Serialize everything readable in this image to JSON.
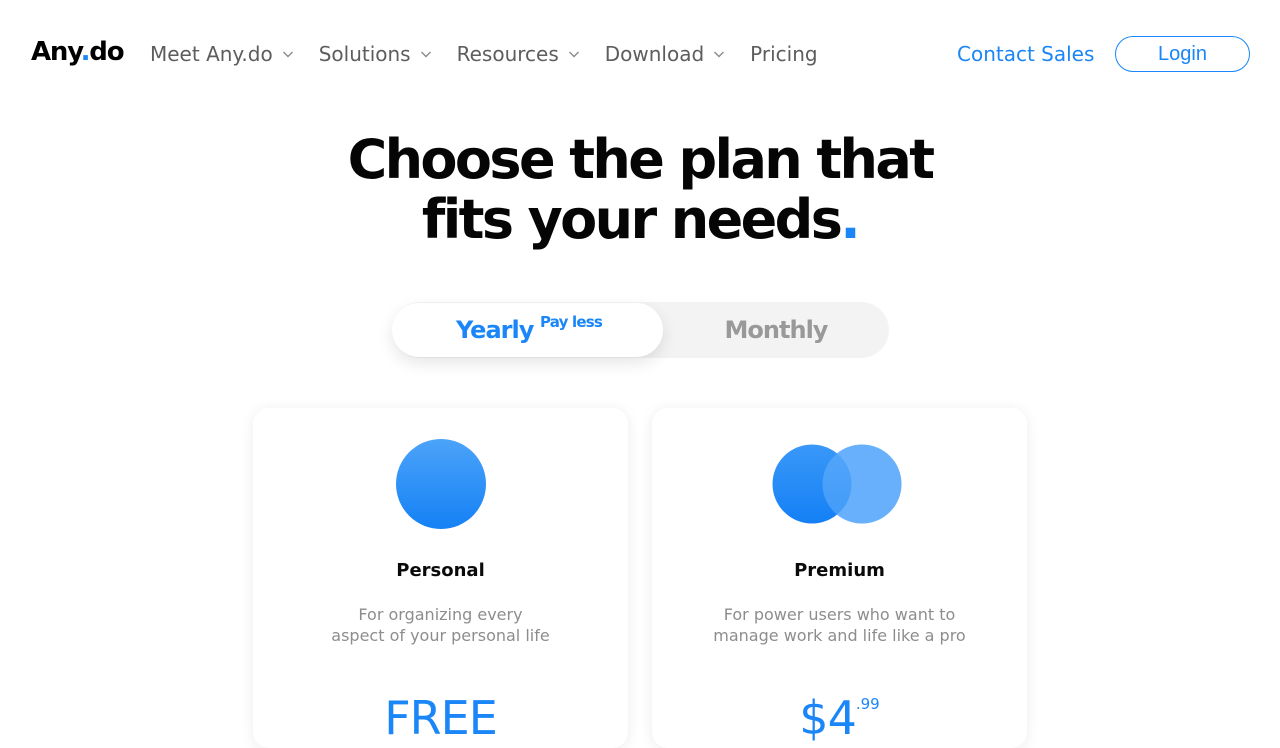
{
  "nav": {
    "logo_text": "Any",
    "logo_dot": ".",
    "logo_suffix": "do",
    "items": [
      {
        "label": "Meet Any.do",
        "has_dropdown": true
      },
      {
        "label": "Solutions",
        "has_dropdown": true
      },
      {
        "label": "Resources",
        "has_dropdown": true
      },
      {
        "label": "Download",
        "has_dropdown": true
      },
      {
        "label": "Pricing",
        "has_dropdown": false
      }
    ],
    "contact_sales": "Contact Sales",
    "login": "Login"
  },
  "hero": {
    "line1": "Choose the plan that",
    "line2": "fits your needs",
    "dot": "."
  },
  "billing_toggle": {
    "yearly_label": "Yearly",
    "yearly_badge": "Pay less",
    "monthly_label": "Monthly",
    "selected": "Yearly"
  },
  "plans": [
    {
      "name": "Personal",
      "description_line1": "For organizing every",
      "description_line2": "aspect of your personal life",
      "price": "FREE",
      "price_cents": ""
    },
    {
      "name": "Premium",
      "description_line1": "For power users who want to",
      "description_line2": "manage work and life like a pro",
      "price": "$4",
      "price_cents": ".99"
    }
  ],
  "colors": {
    "accent": "#1a86f7",
    "nav_text": "#5d5d5d",
    "muted_text": "#8d8d8d",
    "toggle_bg": "#f3f3f3"
  }
}
